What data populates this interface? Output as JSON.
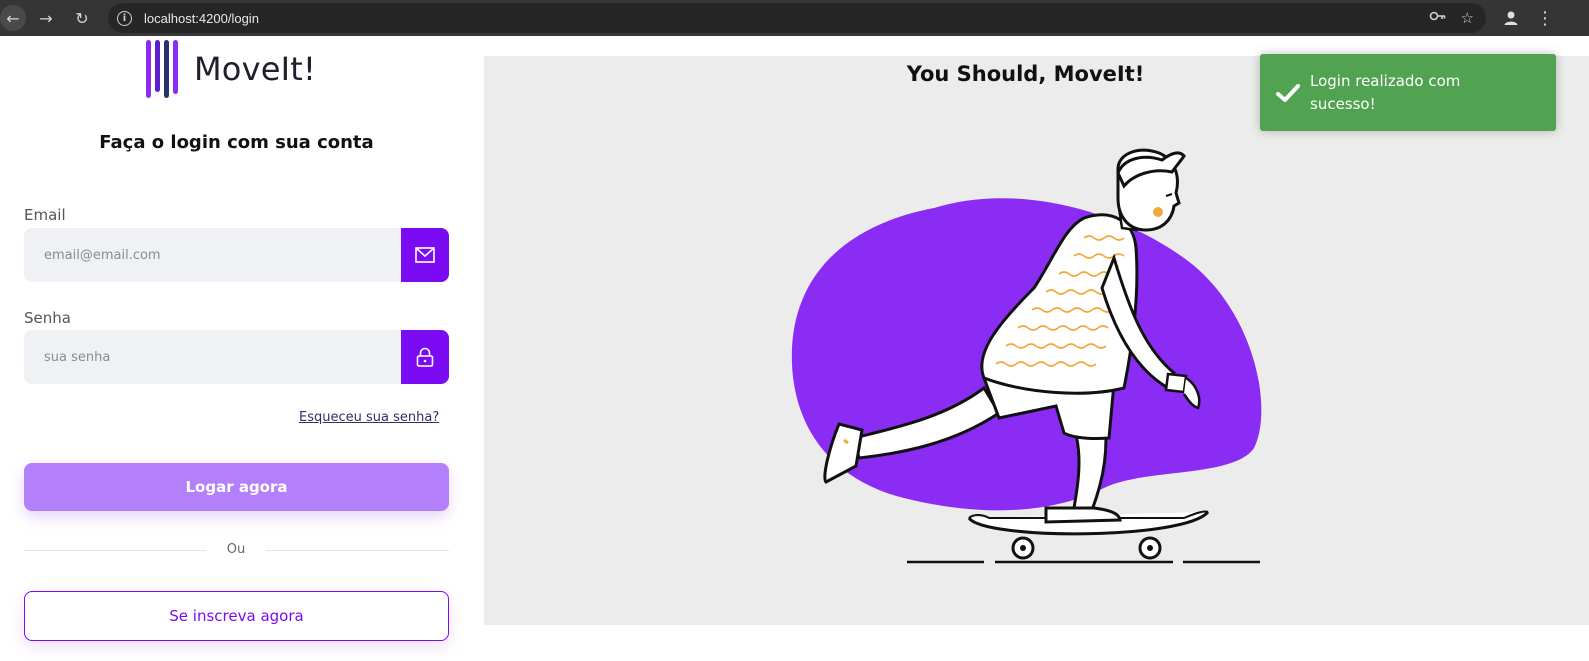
{
  "browser": {
    "url": "localhost:4200/login"
  },
  "logo": {
    "text": "MoveIt!"
  },
  "login": {
    "title": "Faça o login com sua conta",
    "email_label": "Email",
    "email_placeholder": "email@email.com",
    "password_label": "Senha",
    "password_placeholder": "sua senha",
    "forgot_label": "Esqueceu sua senha?",
    "submit_label": "Logar agora",
    "divider_text": "Ou",
    "signup_label": "Se inscreva agora"
  },
  "hero": {
    "title": "You Should, MoveIt!"
  },
  "toast": {
    "message": "Login realizado com sucesso!",
    "icon": "check-icon"
  },
  "colors": {
    "accent": "#7a0bf2",
    "accent_light": "#b47ffb",
    "blob": "#8b2cf5",
    "toast": "#51a351"
  }
}
